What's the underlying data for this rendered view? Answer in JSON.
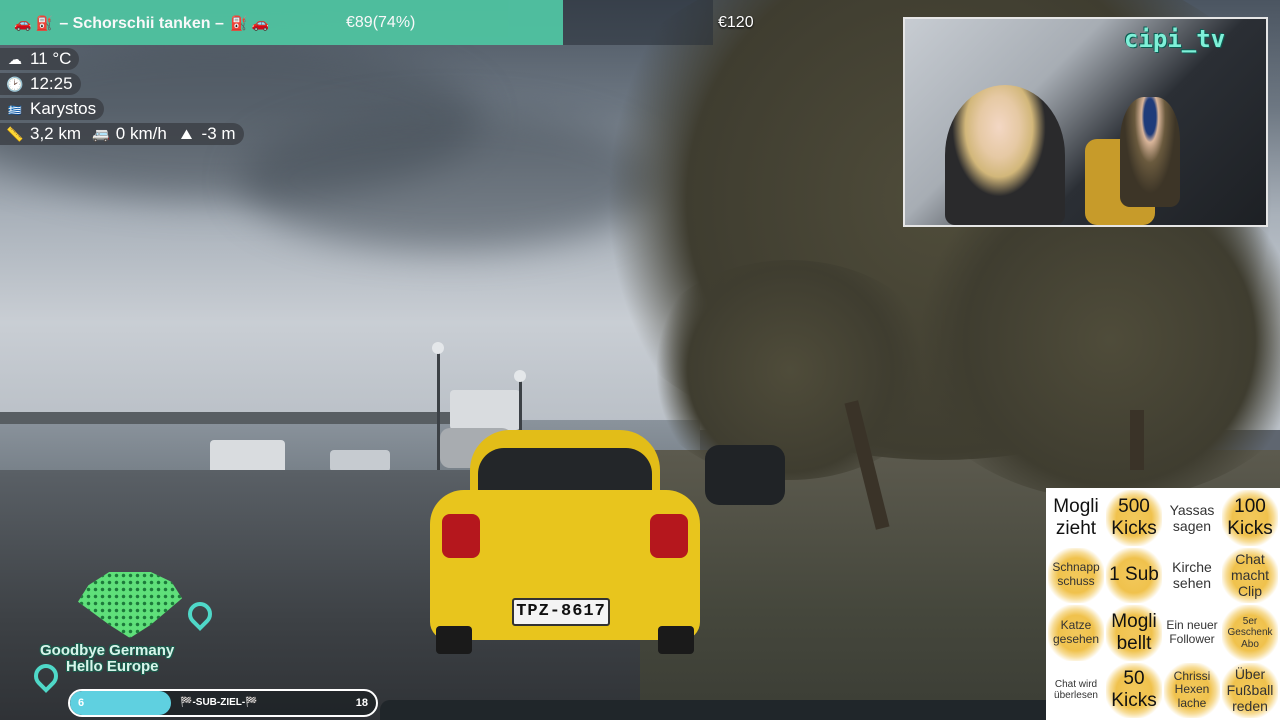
{
  "topbar": {
    "title": "– Schorschii tanken –",
    "progress": "€89(74%)",
    "progress_fraction": 0.74,
    "goal": "€120",
    "accent": "#4fc2a0",
    "icons": [
      "car-icon",
      "fuel-pump-icon"
    ]
  },
  "info": {
    "weather_icon": "cloud-icon",
    "temperature": "11 °C",
    "clock_icon": "clock-icon",
    "time": "12:25",
    "flag_icon": "greece-flag-icon",
    "location": "Karystos",
    "distance_icon": "ruler-icon",
    "distance": "3,2 km",
    "speed_icon": "van-icon",
    "speed": "0 km/h",
    "altitude_icon": "mountain-icon",
    "altitude": "-3 m"
  },
  "camera": {
    "handle": "cipi_tv"
  },
  "scene": {
    "plate": "ΤΡΖ-8617"
  },
  "bingo": {
    "cells": [
      {
        "text": "Mogli zieht",
        "marked": false,
        "size": "big"
      },
      {
        "text": "500 Kicks",
        "marked": true,
        "size": "big"
      },
      {
        "text": "Yassas sagen",
        "marked": false,
        "size": "mid"
      },
      {
        "text": "100 Kicks",
        "marked": true,
        "size": "big"
      },
      {
        "text": "Schnapp schuss",
        "marked": true,
        "size": "sm"
      },
      {
        "text": "1 Sub",
        "marked": true,
        "size": "big"
      },
      {
        "text": "Kirche sehen",
        "marked": false,
        "size": "mid"
      },
      {
        "text": "Chat macht Clip",
        "marked": true,
        "size": "mid"
      },
      {
        "text": "Katze gesehen",
        "marked": true,
        "size": "sm"
      },
      {
        "text": "Mogli bellt",
        "marked": true,
        "size": "big"
      },
      {
        "text": "Ein neuer Follower",
        "marked": false,
        "size": "sm"
      },
      {
        "text": "5er Geschenk Abo",
        "marked": true,
        "size": "xs"
      },
      {
        "text": "Chat wird überlesen",
        "marked": false,
        "size": "xs"
      },
      {
        "text": "50 Kicks",
        "marked": true,
        "size": "big"
      },
      {
        "text": "Chrissi Hexen lache",
        "marked": true,
        "size": "sm"
      },
      {
        "text": "Über Fußball reden",
        "marked": true,
        "size": "mid"
      }
    ]
  },
  "logo": {
    "line1": "Goodbye Germany",
    "line2": "Hello Europe"
  },
  "sub_goal": {
    "current": "6",
    "target": "18",
    "label": "🏁-SUB-ZIEL-🏁",
    "fraction": 0.33,
    "fill_color": "#5fd0e0"
  }
}
